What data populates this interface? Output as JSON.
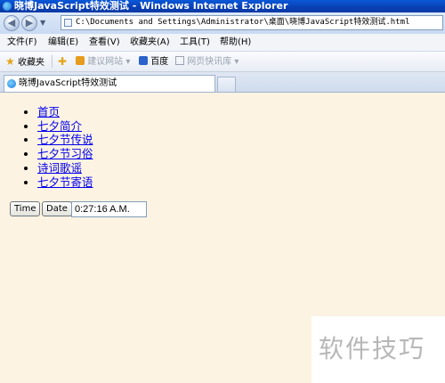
{
  "window": {
    "title": "晓博JavaScript特效测试 - Windows Internet Explorer"
  },
  "address": {
    "value": "C:\\Documents and Settings\\Administrator\\桌面\\晓博JavaScript特效测试.html"
  },
  "menu": {
    "items": [
      "文件(F)",
      "编辑(E)",
      "查看(V)",
      "收藏夹(A)",
      "工具(T)",
      "帮助(H)"
    ]
  },
  "favorites": {
    "label": "收藏夹",
    "suggested_sites": "建议网站 ▾",
    "baidu": "百度",
    "web_slice": "网页快讯库 ▾"
  },
  "tab": {
    "title": "晓博JavaScript特效测试"
  },
  "page": {
    "nav_links": [
      "首页",
      "七夕简介",
      "七夕节传说",
      "七夕节习俗",
      "诗词歌谣",
      "七夕节寄语"
    ],
    "time_button": "Time",
    "date_button": "Date",
    "clock_value": "0:27:16 A.M."
  },
  "watermark": {
    "text": "软件技巧"
  },
  "colors": {
    "title_bar": "#0a4fc8",
    "page_bg": "#fdf3e2",
    "link": "#0000ee"
  }
}
